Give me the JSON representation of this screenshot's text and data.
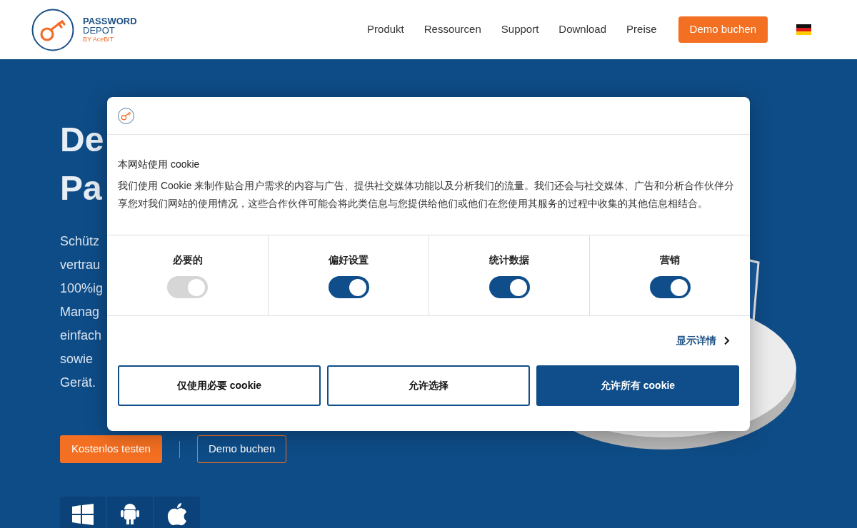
{
  "header": {
    "logo": {
      "line1": "PASSWORD",
      "line2": "DEPOT",
      "line3": "BY AceBIT"
    },
    "nav": [
      "Produkt",
      "Ressourcen",
      "Support",
      "Download",
      "Preise"
    ],
    "cta": "Demo buchen"
  },
  "hero": {
    "heading_lines": [
      "De",
      "Pa"
    ],
    "paragraph_lines": [
      "Schütz",
      "vertrau",
      "100%ig",
      "Manag",
      "einfach",
      "sowie",
      "Gerät."
    ],
    "primary_button": "Kostenlos testen",
    "secondary_button": "Demo buchen"
  },
  "cookie_dialog": {
    "title": "本网站使用 cookie",
    "body": "我们使用 Cookie 来制作贴合用户需求的内容与广告、提供社交媒体功能以及分析我们的流量。我们还会与社交媒体、广告和分析合作伙伴分享您对我们网站的使用情况，这些合作伙伴可能会将此类信息与您提供给他们或他们在您使用其服务的过程中收集的其他信息相结合。",
    "categories": [
      {
        "label": "必要的",
        "on": true,
        "disabled": true
      },
      {
        "label": "偏好设置",
        "on": true,
        "disabled": false
      },
      {
        "label": "统计数据",
        "on": true,
        "disabled": false
      },
      {
        "label": "营销",
        "on": true,
        "disabled": false
      }
    ],
    "details_link": "显示详情",
    "buttons": [
      {
        "label": "仅使用必要 cookie",
        "kind": "outline"
      },
      {
        "label": "允许选择",
        "kind": "outline"
      },
      {
        "label": "允许所有 cookie",
        "kind": "filled"
      }
    ]
  }
}
